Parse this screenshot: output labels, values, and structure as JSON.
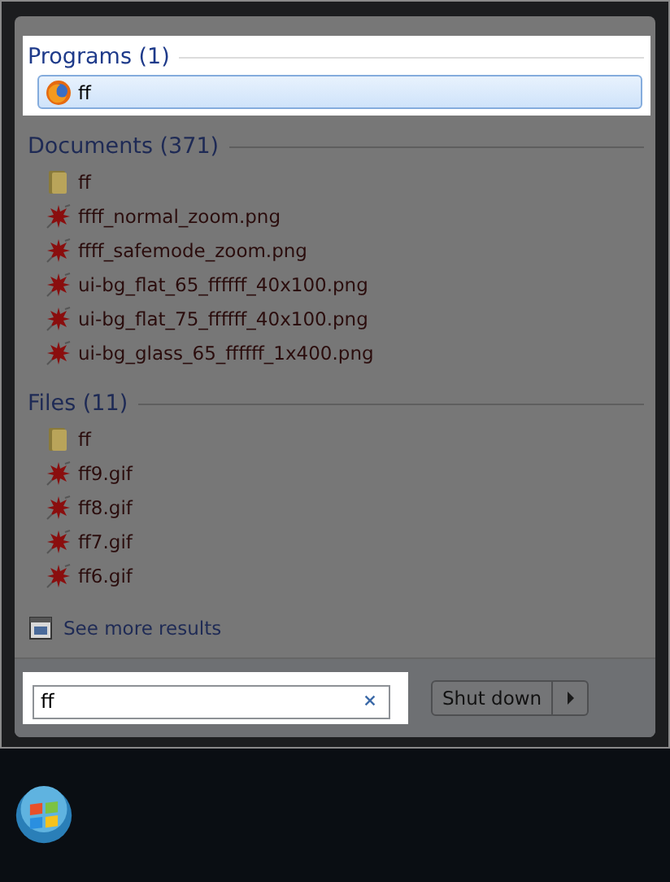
{
  "sections": [
    {
      "title": "Programs (1)",
      "highlighted": true,
      "items": [
        {
          "kind": "app",
          "label": "ff",
          "selected": true
        }
      ]
    },
    {
      "title": "Documents (371)",
      "highlighted": false,
      "items": [
        {
          "kind": "folder",
          "label": "ff",
          "selected": false
        },
        {
          "kind": "image",
          "label": "ffff_normal_zoom.png",
          "selected": false
        },
        {
          "kind": "image",
          "label": "ffff_safemode_zoom.png",
          "selected": false
        },
        {
          "kind": "image",
          "label": "ui-bg_flat_65_ffffff_40x100.png",
          "selected": false
        },
        {
          "kind": "image",
          "label": "ui-bg_flat_75_ffffff_40x100.png",
          "selected": false
        },
        {
          "kind": "image",
          "label": "ui-bg_glass_65_ffffff_1x400.png",
          "selected": false
        }
      ]
    },
    {
      "title": "Files (11)",
      "highlighted": false,
      "items": [
        {
          "kind": "folder",
          "label": "ff",
          "selected": false
        },
        {
          "kind": "image",
          "label": "ff9.gif",
          "selected": false
        },
        {
          "kind": "image",
          "label": "ff8.gif",
          "selected": false
        },
        {
          "kind": "image",
          "label": "ff7.gif",
          "selected": false
        },
        {
          "kind": "image",
          "label": "ff6.gif",
          "selected": false
        }
      ]
    }
  ],
  "see_more": "See more results",
  "search": {
    "value": "ff",
    "highlighted": true
  },
  "shutdown": {
    "label": "Shut down"
  }
}
